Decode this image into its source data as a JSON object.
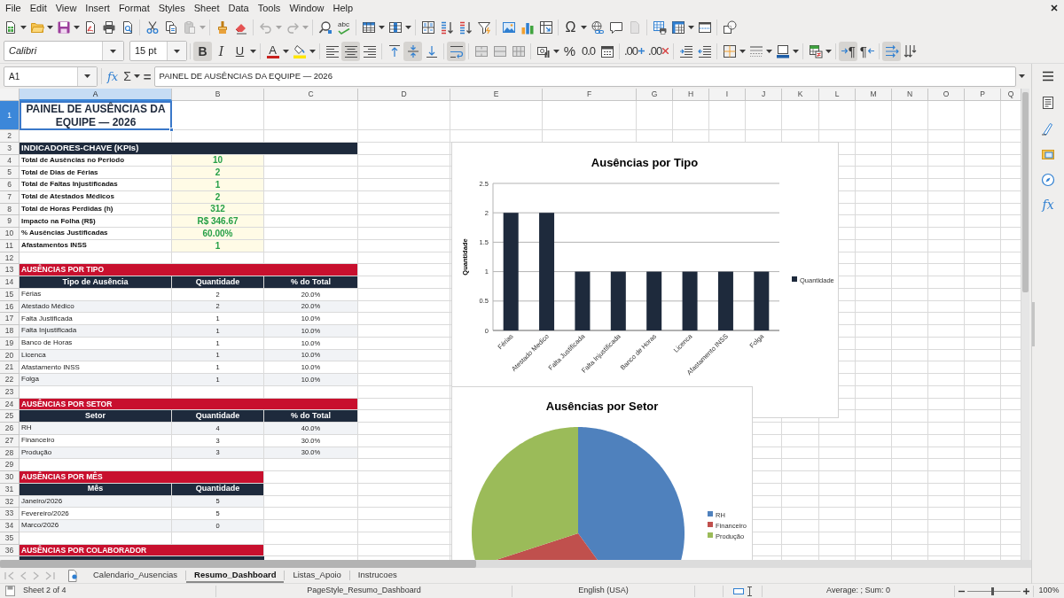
{
  "menu_bar": [
    "File",
    "Edit",
    "View",
    "Insert",
    "Format",
    "Styles",
    "Sheet",
    "Data",
    "Tools",
    "Window",
    "Help"
  ],
  "standard_toolbar": [
    [
      {
        "kind": "new",
        "dropdown": true,
        "disabled": false
      },
      {
        "kind": "open",
        "dropdown": true,
        "disabled": false
      },
      {
        "kind": "save",
        "dropdown": true,
        "disabled": false
      },
      {
        "kind": "export_pdf",
        "disabled": false
      },
      {
        "kind": "print",
        "disabled": false
      },
      {
        "kind": "print_preview",
        "disabled": false
      }
    ],
    [
      {
        "kind": "cut",
        "disabled": false
      },
      {
        "kind": "copy",
        "disabled": false
      },
      {
        "kind": "paste",
        "dropdown": true,
        "disabled": true
      }
    ],
    [
      {
        "kind": "clone_formatting",
        "disabled": false
      },
      {
        "kind": "clear_formatting",
        "disabled": false
      }
    ],
    [
      {
        "kind": "undo",
        "dropdown": true,
        "disabled": true
      },
      {
        "kind": "redo",
        "dropdown": true,
        "disabled": true
      }
    ],
    [
      {
        "kind": "find_replace",
        "disabled": false
      },
      {
        "kind": "spelling",
        "label": "abc",
        "disabled": false
      }
    ],
    [
      {
        "kind": "rows",
        "dropdown": true,
        "disabled": false
      },
      {
        "kind": "columns",
        "dropdown": true,
        "disabled": false
      }
    ],
    [
      {
        "kind": "sort",
        "disabled": false
      },
      {
        "kind": "sort_ascending",
        "disabled": false
      },
      {
        "kind": "sort_descending",
        "disabled": false
      },
      {
        "kind": "autofilter",
        "disabled": false
      }
    ],
    [
      {
        "kind": "image",
        "disabled": false
      },
      {
        "kind": "chart",
        "disabled": false
      },
      {
        "kind": "pivot_table",
        "disabled": false
      }
    ],
    [
      {
        "kind": "special_character",
        "label": "Ω",
        "dropdown": true,
        "disabled": false
      },
      {
        "kind": "hyperlink",
        "disabled": false
      },
      {
        "kind": "comment",
        "disabled": false
      },
      {
        "kind": "header_footer",
        "disabled": true
      }
    ],
    [
      {
        "kind": "print_area",
        "disabled": false
      },
      {
        "kind": "freeze",
        "dropdown": true,
        "disabled": false
      },
      {
        "kind": "split_window",
        "disabled": false
      }
    ],
    [
      {
        "kind": "shapes",
        "disabled": false
      }
    ]
  ],
  "formatting_toolbar": {
    "font_name": "Calibri",
    "font_size": "15 pt",
    "groups": [
      [
        {
          "kind": "bold",
          "label": "B",
          "on": true
        },
        {
          "kind": "italic",
          "label": "I",
          "on": false
        },
        {
          "kind": "underline",
          "label": "U",
          "dropdown": true,
          "on": false
        }
      ],
      [
        {
          "kind": "font_color",
          "label": "A",
          "dropdown": true,
          "on": false
        },
        {
          "kind": "highlight",
          "dropdown": true,
          "on": false
        }
      ],
      [
        {
          "kind": "align_left",
          "on": false
        },
        {
          "kind": "align_center",
          "on": true
        },
        {
          "kind": "align_right",
          "on": false
        }
      ],
      [
        {
          "kind": "align_top",
          "on": false
        },
        {
          "kind": "align_middle",
          "on": true
        },
        {
          "kind": "align_bottom",
          "on": false
        }
      ],
      [
        {
          "kind": "wrap",
          "on": true
        }
      ],
      [
        {
          "kind": "merge_center",
          "on": false
        },
        {
          "kind": "merge",
          "on": false
        },
        {
          "kind": "unmerge",
          "on": false
        }
      ],
      [
        {
          "kind": "number_format",
          "dropdown": true,
          "on": false
        },
        {
          "kind": "percent",
          "label": "%",
          "on": false
        },
        {
          "kind": "decimal",
          "label": "0.0",
          "on": false
        },
        {
          "kind": "date",
          "on": false
        }
      ],
      [
        {
          "kind": "add_decimal",
          "label": ".00",
          "on": false
        },
        {
          "kind": "delete_decimal",
          "label": ".00",
          "on": false
        }
      ],
      [
        {
          "kind": "indent_increase",
          "on": false
        },
        {
          "kind": "indent_decrease",
          "on": false
        }
      ],
      [
        {
          "kind": "borders",
          "dropdown": true,
          "on": false
        },
        {
          "kind": "border_style",
          "dropdown": true,
          "on": false
        },
        {
          "kind": "border_color",
          "dropdown": true,
          "on": false
        }
      ],
      [
        {
          "kind": "conditional",
          "dropdown": true,
          "on": false
        }
      ],
      [
        {
          "kind": "ltr",
          "label": "¶",
          "on": true
        },
        {
          "kind": "rtl",
          "label": "¶",
          "on": false
        }
      ],
      [
        {
          "kind": "text_ltr",
          "on": true
        },
        {
          "kind": "text_ttb",
          "on": false
        }
      ]
    ]
  },
  "formula_bar": {
    "name_box": "A1",
    "function_wizard": "fx",
    "sum": "Σ",
    "equals": "=",
    "formula": "PAINEL DE AUSÊNCIAS DA EQUIPE — 2026"
  },
  "sidebar": {
    "functions": "fx"
  },
  "sheet": {
    "columns": [
      {
        "label": "A",
        "selected": true
      },
      {
        "label": "B",
        "selected": false
      },
      {
        "label": "C",
        "selected": false
      },
      {
        "label": "D",
        "selected": false
      },
      {
        "label": "E",
        "selected": false
      },
      {
        "label": "F",
        "selected": false
      },
      {
        "label": "G",
        "selected": false
      },
      {
        "label": "H",
        "selected": false
      },
      {
        "label": "I",
        "selected": false
      },
      {
        "label": "J",
        "selected": false
      },
      {
        "label": "K",
        "selected": false
      },
      {
        "label": "L",
        "selected": false
      },
      {
        "label": "M",
        "selected": false
      },
      {
        "label": "N",
        "selected": false
      },
      {
        "label": "O",
        "selected": false
      },
      {
        "label": "P",
        "selected": false
      },
      {
        "label": "Q",
        "selected": false
      }
    ],
    "row_headers": [
      {
        "label": "1",
        "selected": true
      },
      {
        "label": "2",
        "selected": false
      },
      {
        "label": "3",
        "selected": false
      },
      {
        "label": "4",
        "selected": false
      },
      {
        "label": "5",
        "selected": false
      },
      {
        "label": "6",
        "selected": false
      },
      {
        "label": "7",
        "selected": false
      },
      {
        "label": "8",
        "selected": false
      },
      {
        "label": "9",
        "selected": false
      },
      {
        "label": "10",
        "selected": false
      },
      {
        "label": "11",
        "selected": false
      },
      {
        "label": "12",
        "selected": false
      },
      {
        "label": "13",
        "selected": false
      },
      {
        "label": "14",
        "selected": false
      },
      {
        "label": "15",
        "selected": false
      },
      {
        "label": "16",
        "selected": false
      },
      {
        "label": "17",
        "selected": false
      },
      {
        "label": "18",
        "selected": false
      },
      {
        "label": "19",
        "selected": false
      },
      {
        "label": "20",
        "selected": false
      },
      {
        "label": "21",
        "selected": false
      },
      {
        "label": "22",
        "selected": false
      },
      {
        "label": "23",
        "selected": false
      },
      {
        "label": "24",
        "selected": false
      },
      {
        "label": "25",
        "selected": false
      },
      {
        "label": "26",
        "selected": false
      },
      {
        "label": "27",
        "selected": false
      },
      {
        "label": "28",
        "selected": false
      },
      {
        "label": "29",
        "selected": false
      },
      {
        "label": "30",
        "selected": false
      },
      {
        "label": "31",
        "selected": false
      },
      {
        "label": "32",
        "selected": false
      },
      {
        "label": "33",
        "selected": false
      },
      {
        "label": "34",
        "selected": false
      },
      {
        "label": "35",
        "selected": false
      },
      {
        "label": "36",
        "selected": false
      }
    ],
    "title": "PAINEL DE AUSÊNCIAS DA EQUIPE — 2026",
    "kpis": {
      "heading": "INDICADORES-CHAVE (KPIs)",
      "rows": [
        {
          "label": "Total de Ausências no Periodo",
          "value": "10"
        },
        {
          "label": "Total de Dias de Férias",
          "value": "2"
        },
        {
          "label": "Total de Faltas Injustificadas",
          "value": "1"
        },
        {
          "label": "Total de Atestados Médicos",
          "value": "2"
        },
        {
          "label": "Total de Horas Perdidas (h)",
          "value": "312"
        },
        {
          "label": "Impacto na Folha (R$)",
          "value": "R$ 346.67"
        },
        {
          "label": "% Ausências Justificadas",
          "value": "60.00%"
        },
        {
          "label": "Afastamentos INSS",
          "value": "1"
        }
      ]
    },
    "tables": [
      {
        "heading": "AUSÊNCIAS POR TIPO",
        "columns": [
          "Tipo de Ausência",
          "Quantidade",
          "% do Total"
        ],
        "rows": [
          [
            "Férias",
            "2",
            "20.0%"
          ],
          [
            "Atestado Médico",
            "2",
            "20.0%"
          ],
          [
            "Falta Justificada",
            "1",
            "10.0%"
          ],
          [
            "Falta Injustificada",
            "1",
            "10.0%"
          ],
          [
            "Banco de Horas",
            "1",
            "10.0%"
          ],
          [
            "Licenca",
            "1",
            "10.0%"
          ],
          [
            "Afastamento INSS",
            "1",
            "10.0%"
          ],
          [
            "Folga",
            "1",
            "10.0%"
          ]
        ]
      },
      {
        "heading": "AUSÊNCIAS POR SETOR",
        "columns": [
          "Setor",
          "Quantidade",
          "% do Total"
        ],
        "rows": [
          [
            "RH",
            "4",
            "40.0%"
          ],
          [
            "Financeiro",
            "3",
            "30.0%"
          ],
          [
            "Produção",
            "3",
            "30.0%"
          ]
        ]
      },
      {
        "heading": "AUSÊNCIAS POR MÊS",
        "columns": [
          "Mês",
          "Quantidade"
        ],
        "rows": [
          [
            "Janeiro/2026",
            "5"
          ],
          [
            "Fevereiro/2026",
            "5"
          ],
          [
            "Marco/2026",
            "0"
          ]
        ]
      },
      {
        "heading": "AUSÊNCIAS POR COLABORADOR"
      }
    ]
  },
  "bar_chart": {
    "chart_data": {
      "type": "bar",
      "title": "Ausências por Tipo",
      "ylabel": "Quantidade",
      "categories": [
        "Férias",
        "Atestado Medico",
        "Falta Justificada",
        "Falta Injustificada",
        "Banco de Horas",
        "Licenca",
        "Afastamento INSS",
        "Folga"
      ],
      "series": [
        {
          "name": "Quantidade",
          "color": "#1e2a3c",
          "values": [
            2,
            2,
            1,
            1,
            1,
            1,
            1,
            1
          ]
        }
      ],
      "ylim": [
        0,
        2.5
      ],
      "yticks": [
        0,
        0.5,
        1,
        1.5,
        2,
        2.5
      ],
      "grid": true
    }
  },
  "pie_chart": {
    "title": "Ausências por Setor",
    "legend": [
      {
        "label": "RH",
        "color": "#4f81bd"
      },
      {
        "label": "Financeiro",
        "color": "#c0504d"
      },
      {
        "label": "Produção",
        "color": "#9bbb59"
      }
    ]
  },
  "sheet_tabs": [
    {
      "label": "Calendario_Ausencias",
      "selected": false
    },
    {
      "label": "Resumo_Dashboard",
      "selected": true
    },
    {
      "label": "Listas_Apoio",
      "selected": false
    },
    {
      "label": "Instrucoes",
      "selected": false
    }
  ],
  "status_bar": {
    "sheet": "Sheet 2 of 4",
    "page_style": "PageStyle_Resumo_Dashboard",
    "language": "English (USA)",
    "selection_summary": "Average: ; Sum: 0",
    "zoom": "100%",
    "zoom_slider": {
      "level": 0.48
    }
  }
}
